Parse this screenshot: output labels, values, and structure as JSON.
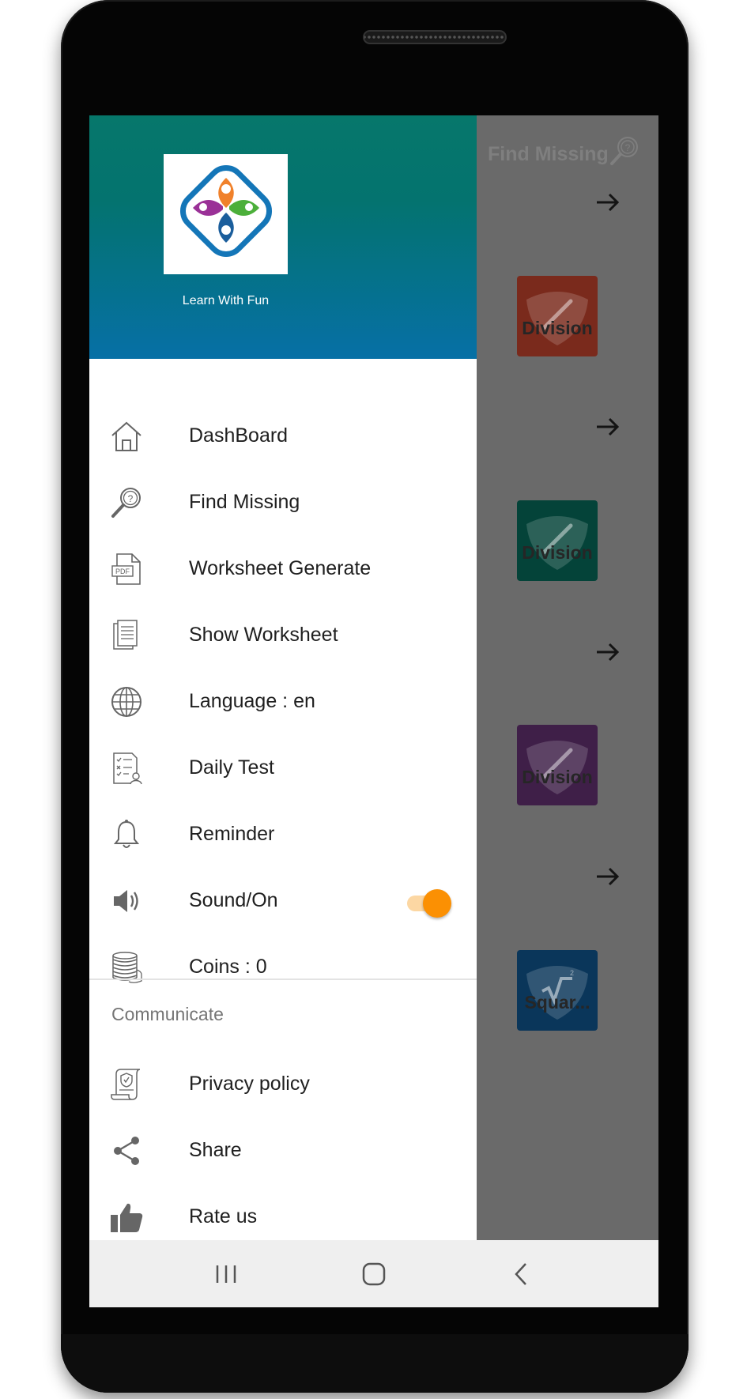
{
  "app": {
    "name": "Learn With Fun"
  },
  "background": {
    "title": "Find Missing",
    "cards": [
      {
        "label": "Division",
        "color": "#7a2a1c",
        "symbol": "division"
      },
      {
        "label": "Division",
        "color": "#044339",
        "symbol": "division"
      },
      {
        "label": "Division",
        "color": "#3f1f48",
        "symbol": "division"
      },
      {
        "label": "Squar...",
        "color": "#0a365a",
        "symbol": "square-root"
      }
    ]
  },
  "drawer": {
    "items": [
      {
        "label": "DashBoard",
        "icon": "home-icon"
      },
      {
        "label": "Find Missing",
        "icon": "magnifier-question-icon"
      },
      {
        "label": "Worksheet Generate",
        "icon": "pdf-file-icon"
      },
      {
        "label": "Show Worksheet",
        "icon": "documents-icon"
      },
      {
        "label": "Language : en",
        "icon": "globe-icon"
      },
      {
        "label": "Daily Test",
        "icon": "test-sheet-icon"
      },
      {
        "label": "Reminder",
        "icon": "bell-icon"
      },
      {
        "label": "Sound/On",
        "icon": "speaker-icon",
        "toggle_on": true
      },
      {
        "label": "Coins : 0",
        "icon": "coins-icon"
      }
    ],
    "communicate_title": "Communicate",
    "communicate_items": [
      {
        "label": "Privacy policy",
        "icon": "privacy-scroll-icon"
      },
      {
        "label": "Share",
        "icon": "share-icon"
      },
      {
        "label": "Rate us",
        "icon": "thumbs-up-icon"
      }
    ]
  },
  "colors": {
    "header_top": "#06776b",
    "header_bottom": "#0670a6",
    "toggle_thumb": "#fb9003",
    "toggle_track": "#fcd7a3"
  }
}
